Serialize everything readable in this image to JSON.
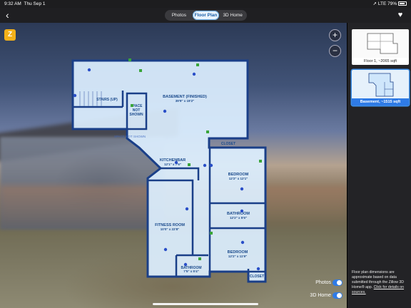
{
  "status": {
    "time": "9:32 AM",
    "date": "Thu Sep 1",
    "signal": "LTE",
    "battery": "79%"
  },
  "tabs": [
    {
      "label": "Photos",
      "active": false
    },
    {
      "label": "Floor Plan",
      "active": true
    },
    {
      "label": "3D Home",
      "active": false
    }
  ],
  "toggles": {
    "photos_label": "Photos",
    "home3d_label": "3D Home"
  },
  "zoom": {
    "in": "+",
    "out": "−"
  },
  "floors": [
    {
      "label": "Floor 1, ~2065 sqft",
      "selected": false
    },
    {
      "label": "Basement, ~1515 sqft",
      "selected": true
    }
  ],
  "disclaimer": {
    "text": "Floor plan dimensions are approximate based on data submitted through the Zillow 3D Home® app.",
    "link": "Click for details on sources."
  },
  "rooms": {
    "stairs": "STAIRS (UP)",
    "space_not_shown_1": "SPACE",
    "space_not_shown_2": "NOT",
    "space_not_shown_3": "SHOWN",
    "basement": "BASEMENT (FINISHED)",
    "basement_dim": "39'9\" x 19'2\"",
    "closet_top": "CLOSET",
    "kitchenbar": "KITCHENBAR",
    "kitchenbar_dim": "12'1\" x 7'6\"",
    "bedroom1": "BEDROOM",
    "bedroom1_dim": "12'2\" x 12'1\"",
    "bathroom1": "BATHROOM",
    "bathroom1_dim": "12'2\" x 5'5\"",
    "fitness": "FITNESS ROOM",
    "fitness_dim": "10'0\" x 22'8\"",
    "bedroom2": "BEDROOM",
    "bedroom2_dim": "12'2\" x 11'9\"",
    "bathroom2": "BATHROOM",
    "bathroom2_dim": "7'5\" x 5'4\"",
    "closet_bottom": "CLOSET",
    "ghost": "SPACE NOT SHOWN"
  },
  "colors": {
    "accent": "#2f7be6",
    "wall": "#1a3f88",
    "floor": "#dcefff",
    "marker_photo": "#3aa53a",
    "marker_3d": "#2a4fc8"
  }
}
